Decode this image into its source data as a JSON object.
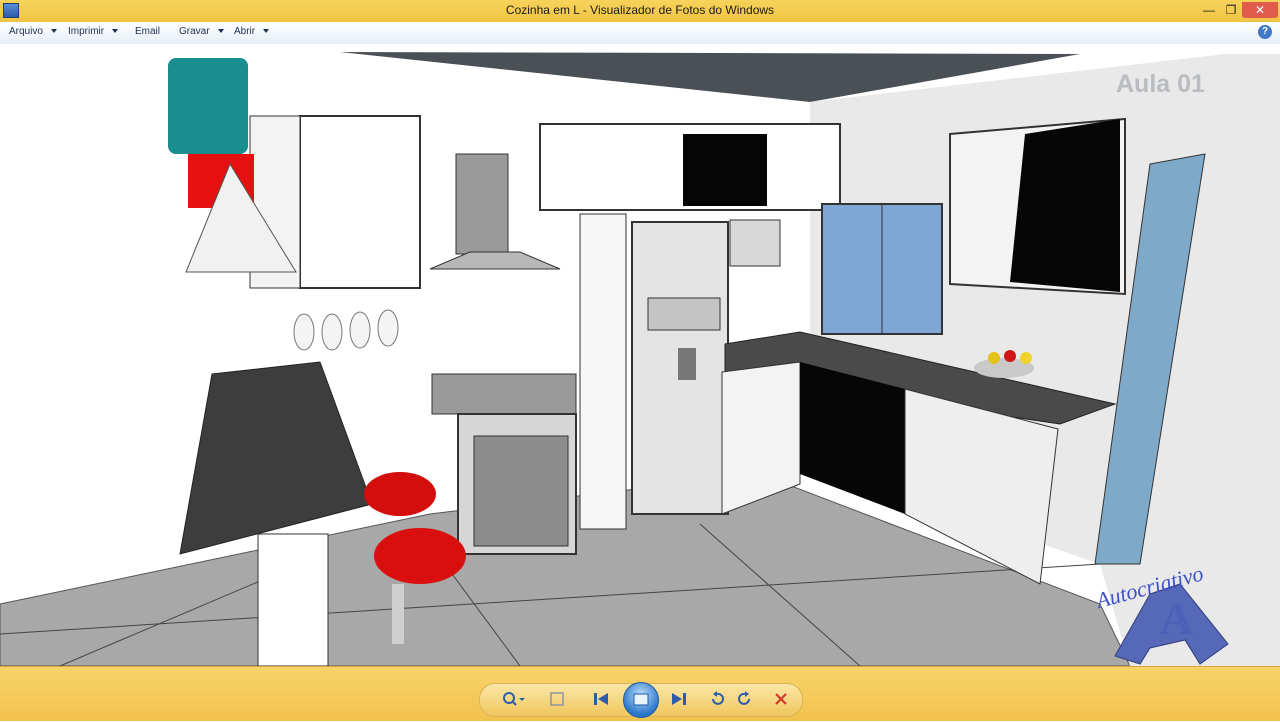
{
  "window": {
    "title": "Cozinha em L - Visualizador de Fotos do Windows"
  },
  "menu": {
    "items": [
      {
        "label": "Arquivo",
        "dropdown": true
      },
      {
        "label": "Imprimir",
        "dropdown": true
      },
      {
        "label": "Email",
        "dropdown": false
      },
      {
        "label": "Gravar",
        "dropdown": true
      },
      {
        "label": "Abrir",
        "dropdown": true
      }
    ],
    "help_label": "?"
  },
  "photo": {
    "watermark": "Aula 01",
    "brand": "Autocriativo",
    "brand_letter": "A"
  },
  "toolbar": {
    "buttons": [
      "zoom-icon",
      "fit-window-icon",
      "previous-icon",
      "slideshow-icon",
      "next-icon",
      "rotate-left-icon",
      "rotate-right-icon",
      "delete-icon"
    ]
  },
  "colors": {
    "title_bar": "#f2c84b",
    "toolbar": "#f4c95a",
    "accent_blue": "#2a76c9",
    "close_red": "#e15b4c"
  }
}
